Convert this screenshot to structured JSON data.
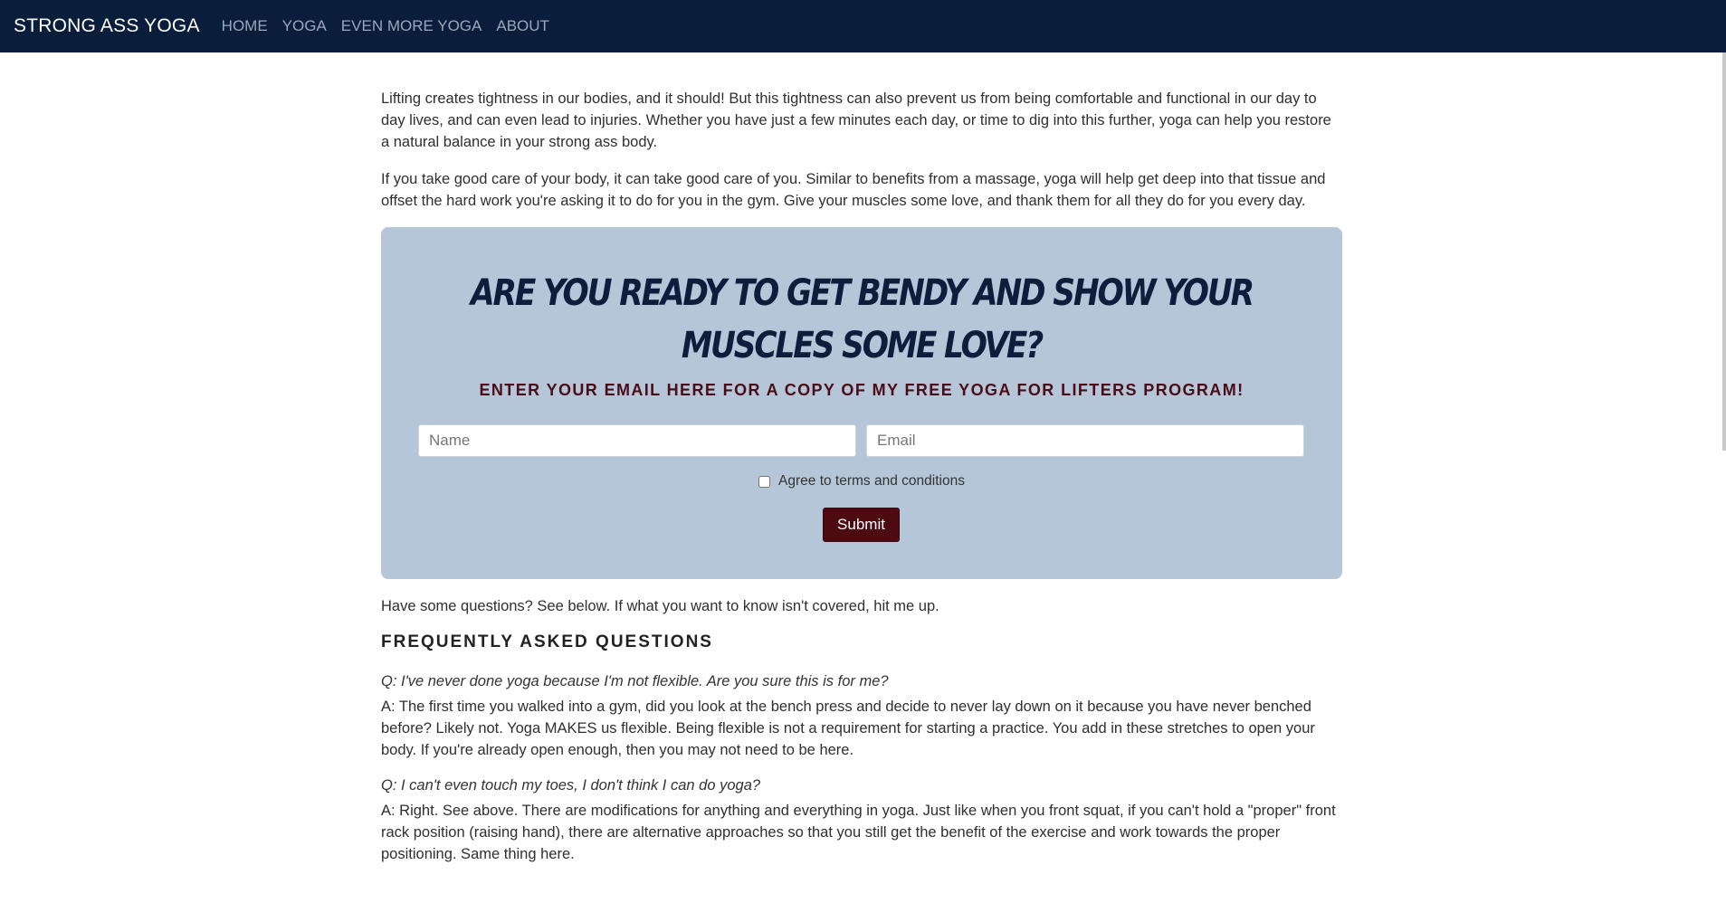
{
  "navbar": {
    "brand": "STRONG ASS YOGA",
    "links": [
      "HOME",
      "YOGA",
      "EVEN MORE YOGA",
      "ABOUT"
    ]
  },
  "intro": {
    "paragraph1": "Lifting creates tightness in our bodies, and it should! But this tightness can also prevent us from being comfortable and functional in our day to day lives, and can even lead to injuries. Whether you have just a few minutes each day, or time to dig into this further, yoga can help you restore a natural balance in your strong ass body.",
    "paragraph2": "If you take good care of your body, it can take good care of you. Similar to benefits from a massage, yoga will help get deep into that tissue and offset the hard work you're asking it to do for you in the gym. Give your muscles some love, and thank them for all they do for you every day."
  },
  "signup": {
    "heading": "Are you ready to get bendy and show your muscles some love?",
    "subheading": "ENTER YOUR EMAIL HERE FOR A COPY OF MY FREE YOGA FOR LIFTERS PROGRAM!",
    "name_placeholder": "Name",
    "email_placeholder": "Email",
    "terms_label": "Agree to terms and conditions",
    "submit_label": "Submit"
  },
  "questions_intro": "Have some questions? See below. If what you want to know isn't covered, hit me up.",
  "faq": {
    "title": "FREQUENTLY ASKED QUESTIONS",
    "items": [
      {
        "q": "Q: I've never done yoga because I'm not flexible. Are you sure this is for me?",
        "a": "A: The first time you walked into a gym, did you look at the bench press and decide to never lay down on it because you have never benched before? Likely not. Yoga MAKES us flexible. Being flexible is not a requirement for starting a practice. You add in these stretches to open your body. If you're already open enough, then you may not need to be here."
      },
      {
        "q": "Q: I can't even touch my toes, I don't think I can do yoga?",
        "a": "A: Right. See above. There are modifications for anything and everything in yoga. Just like when you front squat, if you can't hold a \"proper\" front rack position (raising hand), there are alternative approaches so that you still get the benefit of the exercise and work towards the proper positioning. Same thing here."
      }
    ]
  },
  "colors": {
    "navbar_bg": "#0a1e3c",
    "signup_bg": "#b6c6d9",
    "accent_maroon": "#4d0a10"
  }
}
